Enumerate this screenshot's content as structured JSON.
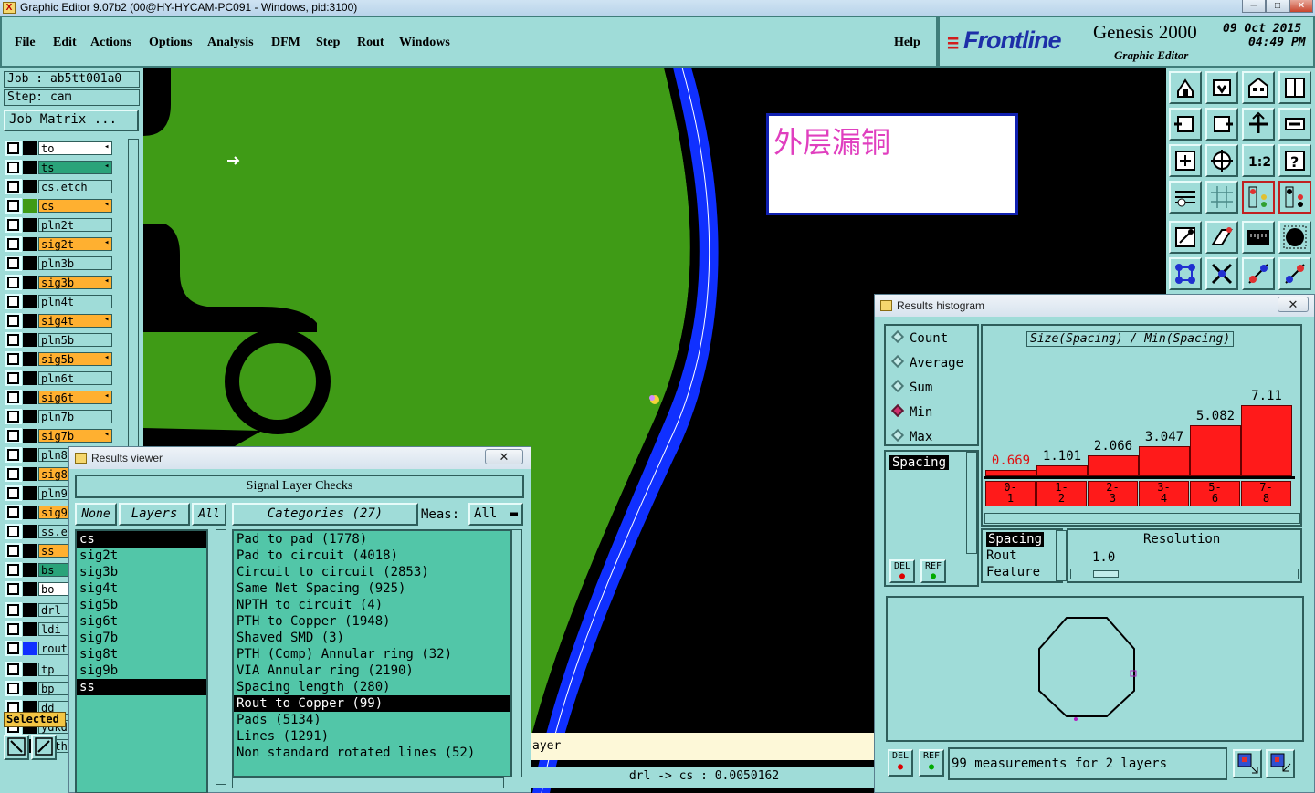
{
  "titlebar": {
    "title": "Graphic Editor 9.07b2 (00@HY-HYCAM-PC091 - Windows, pid:3100)",
    "minimize": "─",
    "maximize": "□",
    "close": "✕"
  },
  "menu": {
    "items": [
      "File",
      "Edit",
      "Actions",
      "Options",
      "Analysis",
      "DFM",
      "Step",
      "Rout",
      "Windows"
    ],
    "help": "Help"
  },
  "brand": {
    "logo": "Frontline",
    "product": "Genesis 2000",
    "subtitle": "Graphic Editor",
    "date": "09 Oct 2015",
    "time": "04:49 PM"
  },
  "left": {
    "job": "Job : ab5tt001a0",
    "step": "Step: cam",
    "job_matrix": "Job Matrix ...",
    "layers": [
      {
        "name": "to",
        "fill": "#ffffff",
        "swatch": "#000000",
        "arrow": "◂"
      },
      {
        "name": "ts",
        "fill": "#2aa37a",
        "swatch": "#000000",
        "arrow": "◂"
      },
      {
        "name": "cs.etch",
        "fill": "#9fdcd8",
        "swatch": "#000000",
        "arrow": ""
      },
      {
        "name": "cs",
        "fill": "#ffb030",
        "swatch": "#3f9b16",
        "arrow": "◂"
      },
      {
        "name": "pln2t",
        "fill": "#9fdcd8",
        "swatch": "#000000",
        "arrow": ""
      },
      {
        "name": "sig2t",
        "fill": "#ffb030",
        "swatch": "#000000",
        "arrow": "◂"
      },
      {
        "name": "pln3b",
        "fill": "#9fdcd8",
        "swatch": "#000000",
        "arrow": ""
      },
      {
        "name": "sig3b",
        "fill": "#ffb030",
        "swatch": "#000000",
        "arrow": "◂"
      },
      {
        "name": "pln4t",
        "fill": "#9fdcd8",
        "swatch": "#000000",
        "arrow": ""
      },
      {
        "name": "sig4t",
        "fill": "#ffb030",
        "swatch": "#000000",
        "arrow": "◂"
      },
      {
        "name": "pln5b",
        "fill": "#9fdcd8",
        "swatch": "#000000",
        "arrow": ""
      },
      {
        "name": "sig5b",
        "fill": "#ffb030",
        "swatch": "#000000",
        "arrow": "◂"
      },
      {
        "name": "pln6t",
        "fill": "#9fdcd8",
        "swatch": "#000000",
        "arrow": ""
      },
      {
        "name": "sig6t",
        "fill": "#ffb030",
        "swatch": "#000000",
        "arrow": "◂"
      },
      {
        "name": "pln7b",
        "fill": "#9fdcd8",
        "swatch": "#000000",
        "arrow": ""
      },
      {
        "name": "sig7b",
        "fill": "#ffb030",
        "swatch": "#000000",
        "arrow": "◂"
      },
      {
        "name": "pln8",
        "fill": "#9fdcd8",
        "swatch": "#000000",
        "arrow": ""
      },
      {
        "name": "sig8",
        "fill": "#ffb030",
        "swatch": "#000000",
        "arrow": ""
      },
      {
        "name": "pln9",
        "fill": "#9fdcd8",
        "swatch": "#000000",
        "arrow": ""
      },
      {
        "name": "sig9",
        "fill": "#ffb030",
        "swatch": "#000000",
        "arrow": ""
      },
      {
        "name": "ss.e",
        "fill": "#9fdcd8",
        "swatch": "#000000",
        "arrow": ""
      },
      {
        "name": "ss",
        "fill": "#ffb030",
        "swatch": "#000000",
        "arrow": ""
      },
      {
        "name": "bs",
        "fill": "#2aa37a",
        "swatch": "#000000",
        "arrow": ""
      },
      {
        "name": "bo",
        "fill": "#ffffff",
        "swatch": "#000000",
        "arrow": ""
      },
      {
        "name": "drl",
        "fill": "#9fdcd8",
        "swatch": "#000000",
        "arrow": ""
      },
      {
        "name": "ldi",
        "fill": "#9fdcd8",
        "swatch": "#000000",
        "arrow": ""
      },
      {
        "name": "rout",
        "fill": "#9fdcd8",
        "swatch": "#1030ff",
        "arrow": ""
      },
      {
        "name": "tp",
        "fill": "#9fdcd8",
        "swatch": "#000000",
        "arrow": ""
      },
      {
        "name": "bp",
        "fill": "#9fdcd8",
        "swatch": "#000000",
        "arrow": ""
      },
      {
        "name": "dd",
        "fill": "#9fdcd8",
        "swatch": "#000000",
        "arrow": ""
      },
      {
        "name": "ydkd",
        "fill": "#9fdcd8",
        "swatch": "#000000",
        "arrow": ""
      },
      {
        "name": "mnth",
        "fill": "#9fdcd8",
        "swatch": "#000000",
        "arrow": ""
      }
    ],
    "selected_label": "Selected"
  },
  "canvas": {
    "annotation": "外层漏铜",
    "status_left": "ayer",
    "status_measure": "drl -> cs : 0.0050162"
  },
  "tools": {
    "icons": [
      "home-icon",
      "save-icon",
      "building-icon",
      "frame-icon",
      "zoom-out-icon",
      "zoom-in-icon",
      "zoom-fit-icon",
      "pan-icon",
      "fit-page-icon",
      "center-icon",
      "one-to-one-icon",
      "help-icon",
      "settings-icon",
      "grid-icon",
      "layers-icon",
      "layers-active-icon",
      "snap-icon",
      "measure-icon",
      "ruler-icon",
      "target-icon",
      "net-icon",
      "cross-icon",
      "point-icon",
      "line-icon"
    ]
  },
  "results_viewer": {
    "title": "Results viewer",
    "close": "✕",
    "header": "Signal Layer Checks",
    "none_btn": "None",
    "layers_btn": "Layers",
    "all_btn": "All",
    "categories_btn": "Categories (27)",
    "meas_label": "Meas:",
    "meas_value": "All",
    "layers": [
      "cs",
      "sig2t",
      "sig3b",
      "sig4t",
      "sig5b",
      "sig6t",
      "sig7b",
      "sig8t",
      "sig9b",
      "ss"
    ],
    "selected_layers": [
      "cs",
      "ss"
    ],
    "categories": [
      "Pad to pad (1778)",
      "Pad to circuit (4018)",
      "Circuit to circuit (2853)",
      "Same Net Spacing (925)",
      "NPTH to circuit (4)",
      "PTH to Copper (1948)",
      "Shaved SMD (3)",
      "PTH (Comp) Annular ring (32)",
      "VIA Annular ring (2190)",
      "Spacing length (280)",
      "Rout to Copper (99)",
      "Pads (5134)",
      "Lines (1291)",
      "Non standard rotated lines (52)"
    ],
    "selected_category": "Rout to Copper (99)"
  },
  "histogram": {
    "title": "Results histogram",
    "close": "✕",
    "modes": [
      "Count",
      "Average",
      "Sum",
      "Min",
      "Max"
    ],
    "selected_mode": "Min",
    "chart_title": "Size(Spacing) / Min(Spacing)",
    "list_items": [
      "Spacing"
    ],
    "del": "DEL",
    "ref": "REF",
    "bins": [
      {
        "range_top": "0-",
        "range_bottom": "1",
        "value": 0.669,
        "label": "0.669"
      },
      {
        "range_top": "1-",
        "range_bottom": "2",
        "value": 1.101,
        "label": "1.101"
      },
      {
        "range_top": "2-",
        "range_bottom": "3",
        "value": 2.066,
        "label": "2.066"
      },
      {
        "range_top": "3-",
        "range_bottom": "4",
        "value": 3.047,
        "label": "3.047"
      },
      {
        "range_top": "5-",
        "range_bottom": "6",
        "value": 5.082,
        "label": "5.082"
      },
      {
        "range_top": "7-",
        "range_bottom": "8",
        "value": 7.11,
        "label": "7.11"
      }
    ],
    "ymax": 7.11,
    "attr_items": [
      "Spacing",
      "Rout",
      "Feature"
    ],
    "resolution_label": "Resolution",
    "resolution_value": "1.0",
    "status": "99 measurements for 2 layers"
  },
  "colors": {
    "teal": "#9fdcd8",
    "copper_green": "#3f9b16",
    "rout_blue": "#1030ff",
    "bar_red": "#ff1a1a"
  }
}
